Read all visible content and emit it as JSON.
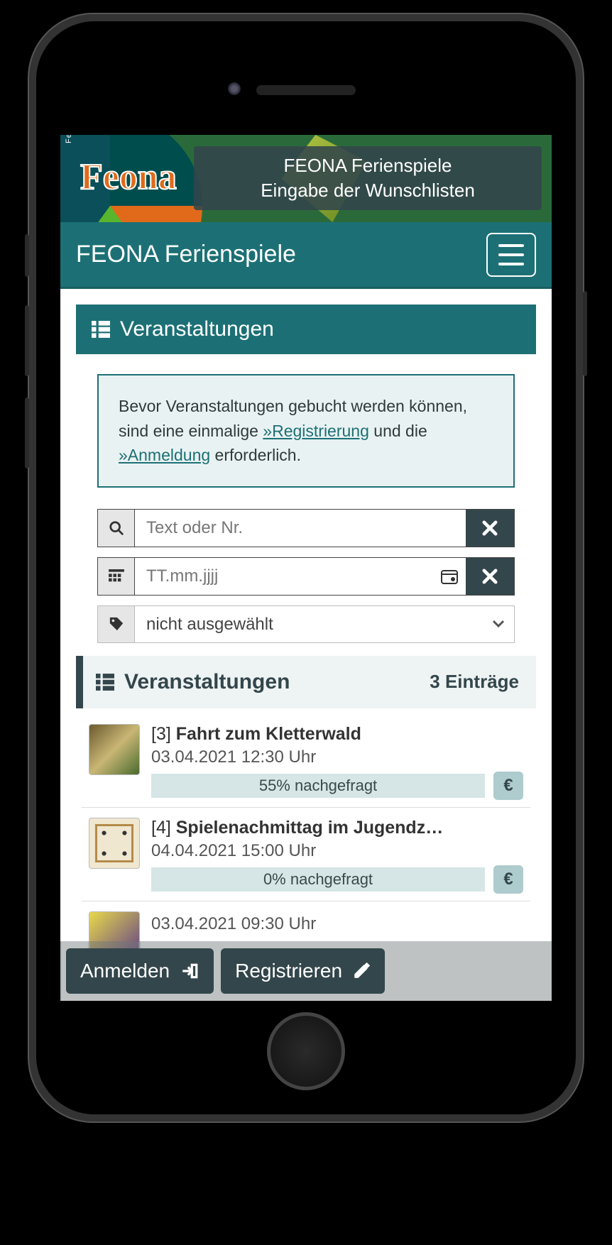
{
  "banner": {
    "logo_text": "Feona",
    "logo_side": "Ferienspiele mit",
    "title_line1": "FEONA Ferienspiele",
    "title_line2": "Eingabe der Wunschlisten"
  },
  "navbar": {
    "title": "FEONA Ferienspiele"
  },
  "section": {
    "title": "Veranstaltungen"
  },
  "info": {
    "text_before": "Bevor Veranstaltungen gebucht werden können, sind eine einmalige ",
    "link1": "»Registrierung",
    "text_mid": " und die ",
    "link2": "»Anmeldung",
    "text_after": " erforderlich."
  },
  "filters": {
    "text_placeholder": "Text oder Nr.",
    "date_placeholder": "TT.mm.jjjj",
    "select_value": "nicht ausgewählt"
  },
  "list_header": {
    "title": "Veranstaltungen",
    "count_label": "3 Einträge"
  },
  "events": [
    {
      "num": "[3]",
      "title": "Fahrt zum Kletterwald",
      "datetime": "03.04.2021 12:30 Uhr",
      "demand": "55% nachgefragt",
      "thumb": "forest"
    },
    {
      "num": "[4]",
      "title": "Spielenachmittag im Jugendz…",
      "datetime": "04.04.2021 15:00 Uhr",
      "demand": "0% nachgefragt",
      "thumb": "board"
    },
    {
      "num": "",
      "title": "",
      "datetime": "03.04.2021 09:30 Uhr",
      "demand": "",
      "thumb": "art"
    }
  ],
  "actions": {
    "login": "Anmelden",
    "register": "Registrieren"
  },
  "euro": "€"
}
